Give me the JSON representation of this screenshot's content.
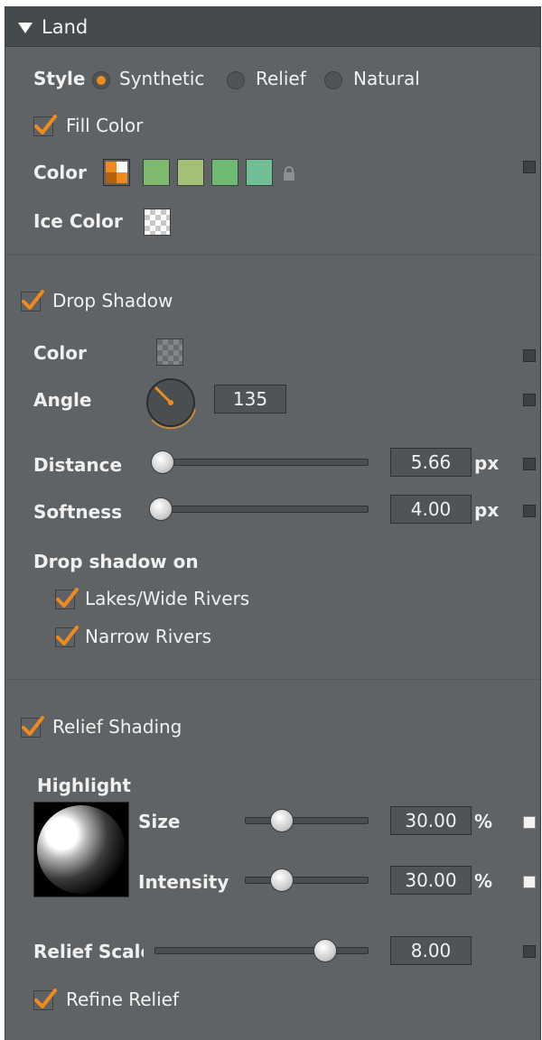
{
  "section": {
    "title": "Land"
  },
  "style_row": {
    "label": "Style",
    "options": [
      "Synthetic",
      "Relief",
      "Natural"
    ],
    "selected": "Synthetic"
  },
  "fill_color": {
    "label": "Fill Color",
    "checked": true
  },
  "color_row": {
    "label": "Color",
    "swatches": [
      "#7dba6e",
      "#a4c077",
      "#6fb970",
      "#6fbf95"
    ],
    "selected_color": "#e88a1e"
  },
  "ice_color": {
    "label": "Ice Color"
  },
  "drop_shadow": {
    "label": "Drop Shadow",
    "checked": true,
    "color_label": "Color",
    "angle_label": "Angle",
    "angle_value": "135",
    "distance_label": "Distance",
    "distance_value": "5.66",
    "distance_unit": "px",
    "distance_level": 0.02,
    "softness_label": "Softness",
    "softness_value": "4.00",
    "softness_unit": "px",
    "softness_level": 0.0,
    "on_label": "Drop shadow on",
    "lakes_label": "Lakes/Wide Rivers",
    "lakes_checked": true,
    "narrow_label": "Narrow Rivers",
    "narrow_checked": true
  },
  "relief_shading": {
    "label": "Relief Shading",
    "checked": true,
    "highlight_label": "Highlight",
    "size_label": "Size",
    "size_value": "30.00",
    "size_unit": "%",
    "size_level": 0.3,
    "intensity_label": "Intensity",
    "intensity_value": "30.00",
    "intensity_unit": "%",
    "intensity_level": 0.3,
    "scale_label": "Relief Scale",
    "scale_value": "8.00",
    "scale_level": 0.8,
    "refine_label": "Refine Relief",
    "refine_checked": true
  },
  "accent_color": "#f08a1c"
}
